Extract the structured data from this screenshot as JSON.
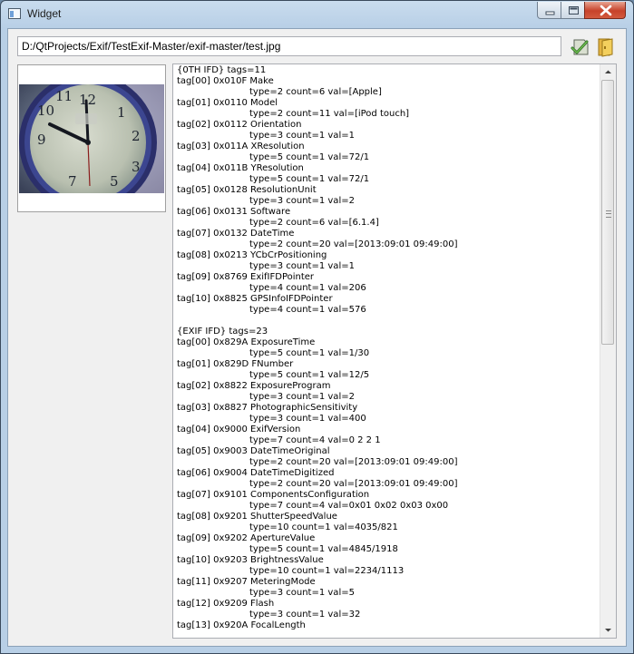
{
  "window": {
    "title": "Widget"
  },
  "toolbar": {
    "path_value": "D:/QtProjects/Exif/TestExif-Master/exif-master/test.jpg",
    "open_icon": "check-document-icon",
    "folder_icon": "folder-icon"
  },
  "preview": {
    "image": "wall clock photo"
  },
  "exif": {
    "ifd0": {
      "header": "{0TH IFD} tags=11",
      "tags": [
        {
          "id": "tag[00] 0x010F Make",
          "info": "type=2 count=6 val=[Apple]"
        },
        {
          "id": "tag[01] 0x0110 Model",
          "info": "type=2 count=11 val=[iPod touch]"
        },
        {
          "id": "tag[02] 0x0112 Orientation",
          "info": "type=3 count=1 val=1"
        },
        {
          "id": "tag[03] 0x011A XResolution",
          "info": "type=5 count=1 val=72/1"
        },
        {
          "id": "tag[04] 0x011B YResolution",
          "info": "type=5 count=1 val=72/1"
        },
        {
          "id": "tag[05] 0x0128 ResolutionUnit",
          "info": "type=3 count=1 val=2"
        },
        {
          "id": "tag[06] 0x0131 Software",
          "info": "type=2 count=6 val=[6.1.4]"
        },
        {
          "id": "tag[07] 0x0132 DateTime",
          "info": "type=2 count=20 val=[2013:09:01 09:49:00]"
        },
        {
          "id": "tag[08] 0x0213 YCbCrPositioning",
          "info": "type=3 count=1 val=1"
        },
        {
          "id": "tag[09] 0x8769 ExifIFDPointer",
          "info": "type=4 count=1 val=206"
        },
        {
          "id": "tag[10] 0x8825 GPSInfoIFDPointer",
          "info": "type=4 count=1 val=576"
        }
      ]
    },
    "exif_ifd": {
      "header": "{EXIF IFD} tags=23",
      "tags": [
        {
          "id": "tag[00] 0x829A ExposureTime",
          "info": "type=5 count=1 val=1/30"
        },
        {
          "id": "tag[01] 0x829D FNumber",
          "info": "type=5 count=1 val=12/5"
        },
        {
          "id": "tag[02] 0x8822 ExposureProgram",
          "info": "type=3 count=1 val=2"
        },
        {
          "id": "tag[03] 0x8827 PhotographicSensitivity",
          "info": "type=3 count=1 val=400"
        },
        {
          "id": "tag[04] 0x9000 ExifVersion",
          "info": "type=7 count=4 val=0 2 2 1"
        },
        {
          "id": "tag[05] 0x9003 DateTimeOriginal",
          "info": "type=2 count=20 val=[2013:09:01 09:49:00]"
        },
        {
          "id": "tag[06] 0x9004 DateTimeDigitized",
          "info": "type=2 count=20 val=[2013:09:01 09:49:00]"
        },
        {
          "id": "tag[07] 0x9101 ComponentsConfiguration",
          "info": "type=7 count=4 val=0x01 0x02 0x03 0x00"
        },
        {
          "id": "tag[08] 0x9201 ShutterSpeedValue",
          "info": "type=10 count=1 val=4035/821"
        },
        {
          "id": "tag[09] 0x9202 ApertureValue",
          "info": "type=5 count=1 val=4845/1918"
        },
        {
          "id": "tag[10] 0x9203 BrightnessValue",
          "info": "type=10 count=1 val=2234/1113"
        },
        {
          "id": "tag[11] 0x9207 MeteringMode",
          "info": "type=3 count=1 val=5"
        },
        {
          "id": "tag[12] 0x9209 Flash",
          "info": "type=3 count=1 val=32"
        },
        {
          "id": "tag[13] 0x920A FocalLength",
          "info": ""
        }
      ]
    }
  },
  "scrollbar": {
    "position": 0.0
  }
}
